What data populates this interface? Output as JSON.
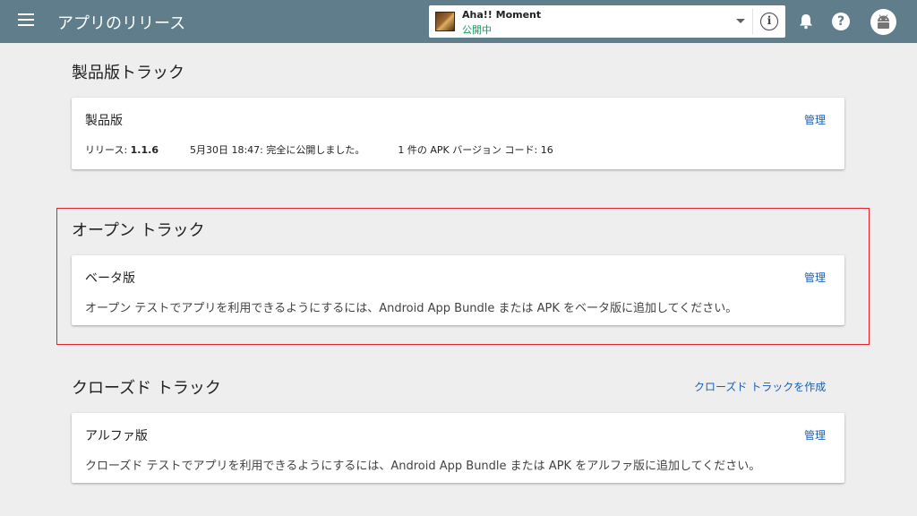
{
  "header": {
    "title": "アプリのリリース",
    "app_name": "Aha!! Moment",
    "app_status": "公開中",
    "info_glyph": "i",
    "help_glyph": "?",
    "colors": {
      "bar": "#607d8b",
      "status": "#0f9d58",
      "link": "#1a5fb4",
      "highlight": "#e8202e"
    }
  },
  "production": {
    "section_title": "製品版トラック",
    "card_title": "製品版",
    "manage": "管理",
    "release_prefix": "リリース: ",
    "release_version": "1.1.6",
    "release_date": "5月30日 18:47: 完全に公開しました。",
    "apk_info": "1 件の APK バージョン コード: 16"
  },
  "open_track": {
    "section_title": "オープン トラック",
    "card_title": "ベータ版",
    "manage": "管理",
    "description": "オープン テストでアプリを利用できるようにするには、Android App Bundle または APK をベータ版に追加してください。"
  },
  "closed_track": {
    "section_title": "クローズド トラック",
    "create_link": "クローズド トラックを作成",
    "card_title": "アルファ版",
    "manage": "管理",
    "description": "クローズド テストでアプリを利用できるようにするには、Android App Bundle または APK をアルファ版に追加してください。"
  }
}
